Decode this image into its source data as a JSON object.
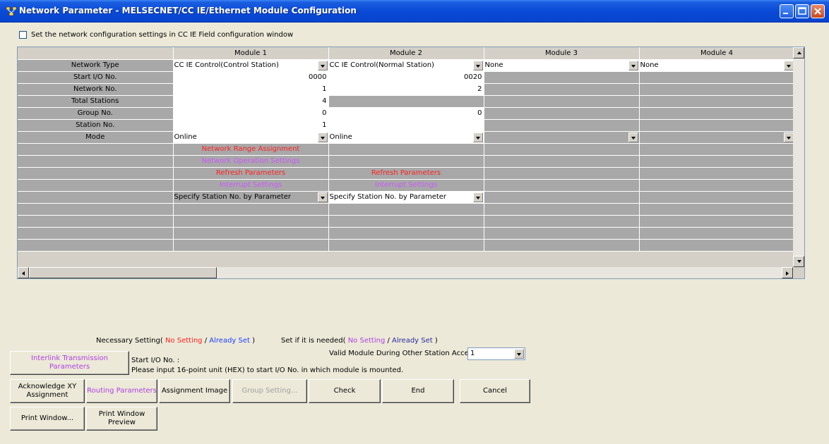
{
  "window": {
    "title": "Network Parameter - MELSECNET/CC IE/Ethernet Module Configuration"
  },
  "checkbox": {
    "label": "Set the network configuration settings in CC IE Field configuration window",
    "checked": false
  },
  "grid": {
    "columns": [
      "Module 1",
      "Module 2",
      "Module 3",
      "Module 4"
    ],
    "network_type": [
      "CC IE Control(Control Station)",
      "CC IE Control(Normal Station)",
      "None",
      "None"
    ],
    "start_io": [
      "0000",
      "0020"
    ],
    "network_no": [
      "1",
      "2"
    ],
    "total_stations": [
      "4"
    ],
    "group_no": [
      "0",
      "0"
    ],
    "station_no": [
      "1"
    ],
    "mode": [
      "Online",
      "Online"
    ],
    "network_range_assignment": "Network Range Assignment",
    "network_operation_settings": "Network Operation Settings",
    "refresh_parameters": [
      "Refresh Parameters",
      "Refresh Parameters"
    ],
    "interrupt_settings": [
      "Interrupt Settings",
      "Interrupt Settings"
    ],
    "station_spec": [
      "Specify Station No. by Parameter",
      "Specify Station No. by Parameter"
    ],
    "row_labels": {
      "network_type": "Network Type",
      "start_io": "Start I/O No.",
      "network_no": "Network No.",
      "total_stations": "Total Stations",
      "group_no": "Group No.",
      "station_no": "Station No.",
      "mode": "Mode"
    }
  },
  "legend": {
    "necessary_prefix": "Necessary Setting(",
    "needed_prefix": "Set if it is needed(",
    "no_setting": "No Setting",
    "slash": "/",
    "already_set": "Already Set",
    "close": ")"
  },
  "valid_module": {
    "label": "Valid Module During Other Station Access",
    "value": "1"
  },
  "info": {
    "line1": "Start I/O No. :",
    "line2": "Please input 16-point unit (HEX) to start I/O No. in which module is mounted."
  },
  "buttons": {
    "interlink": "Interlink Transmission Parameters",
    "ack_xy_1": "Acknowledge XY",
    "ack_xy_2": "Assignment",
    "routing": "Routing Parameters",
    "assignment_image": "Assignment Image",
    "group_setting": "Group Setting...",
    "check": "Check",
    "end": "End",
    "cancel": "Cancel",
    "print_window": "Print Window...",
    "print_preview_1": "Print Window",
    "print_preview_2": "Preview"
  },
  "colors": {
    "titlebar": "#0a4ad6",
    "no_setting": "#ff2020",
    "already_set": "#1f40ff",
    "optional_no_setting": "#b040e0"
  }
}
